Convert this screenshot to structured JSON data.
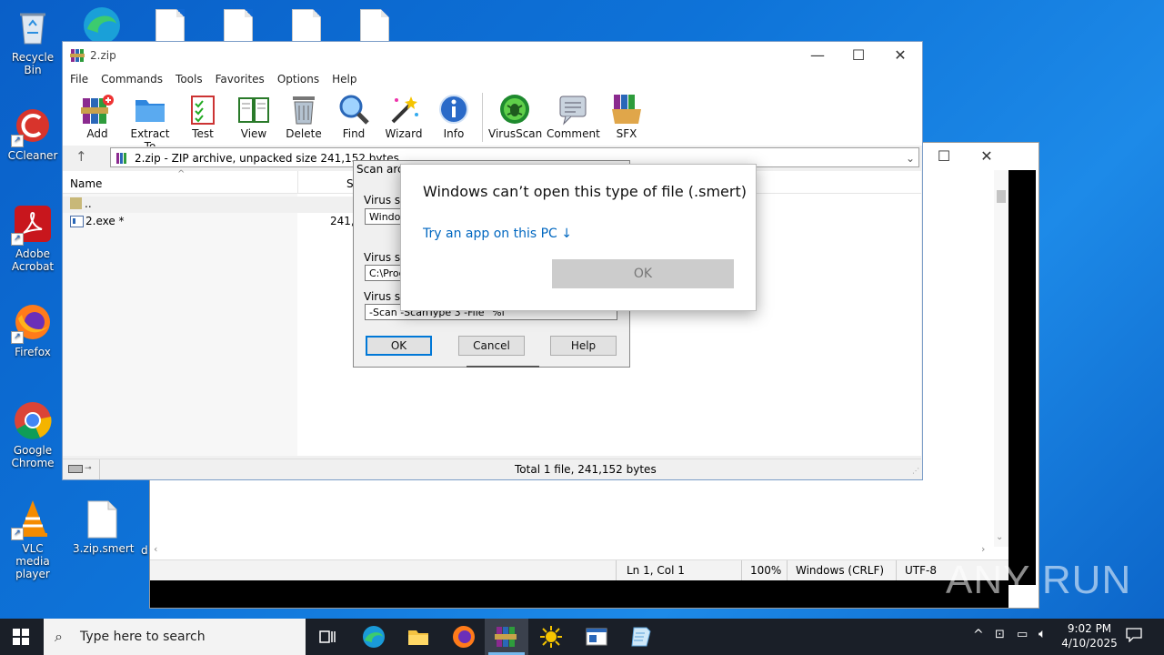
{
  "desktop": {
    "icons": [
      {
        "label": "Recycle Bin"
      },
      {
        "label": "CCleaner"
      },
      {
        "label": "Adobe Acrobat"
      },
      {
        "label": "Firefox"
      },
      {
        "label": "Google Chrome"
      },
      {
        "label": "VLC media player"
      },
      {
        "label": "3.zip.smert"
      },
      {
        "label": "d"
      }
    ]
  },
  "notepad": {
    "status": {
      "position": "Ln 1, Col 1",
      "zoom": "100%",
      "line_ending": "Windows (CRLF)",
      "encoding": "UTF-8"
    }
  },
  "winrar": {
    "title": "2.zip",
    "menu": [
      "File",
      "Commands",
      "Tools",
      "Favorites",
      "Options",
      "Help"
    ],
    "toolbar": [
      "Add",
      "Extract To",
      "Test",
      "View",
      "Delete",
      "Find",
      "Wizard",
      "Info",
      "VirusScan",
      "Comment",
      "SFX"
    ],
    "address": "2.zip - ZIP archive, unpacked size 241,152 bytes",
    "columns": {
      "name": "Name",
      "size": "Si"
    },
    "rows": [
      {
        "name": "..",
        "size": ""
      },
      {
        "name": "2.exe *",
        "size": "241,1"
      }
    ],
    "status_total": "Total 1 file, 241,152 bytes"
  },
  "scan_dialog": {
    "title": "Scan arch",
    "label1": "Virus sca",
    "field1": "Window",
    "label2": "Virus sca",
    "field2": "C:\\Prog",
    "label3": "Virus sca",
    "field3": "-Scan -ScanType 3 -File \"%f\"",
    "ok": "OK",
    "cancel": "Cancel",
    "help": "Help"
  },
  "open_with": {
    "heading": "Windows can’t open this type of file (.smert)",
    "link": "Try an app on this PC ↓",
    "ok": "OK"
  },
  "taskbar": {
    "search_placeholder": "Type here to search",
    "time": "9:02 PM",
    "date": "4/10/2025"
  },
  "watermark": "ANY RUN",
  "colors": {
    "accent": "#0067c0",
    "desktop": "#0e73d8",
    "taskbar": "#1a1f28"
  }
}
